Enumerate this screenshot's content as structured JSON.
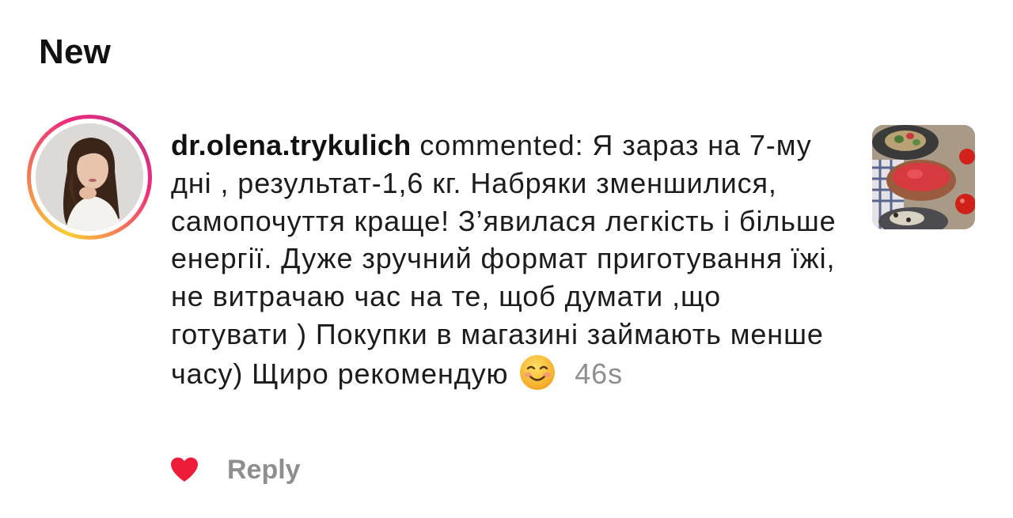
{
  "section": {
    "title": "New"
  },
  "comment": {
    "username": "dr.olena.trykulich",
    "action": "commented:",
    "text": "Я зараз на 7-му дні , результат-1,6 кг. Набряки зменшилися, самопочуття краще! З’явилася легкість і більше енергії. Дуже зручний формат приготування їжі, не витрачаю час на те, щоб думати ,що готувати ) Покупки в магазині займають менше часу) Щиро рекомендую",
    "emoji": "smiling-face-icon",
    "time": "46s"
  },
  "actions": {
    "like_icon": "heart-icon",
    "like_color": "#ed1c3a",
    "reply_label": "Reply"
  },
  "colors": {
    "story_ring_start": "#f9ce34",
    "story_ring_end": "#ee2a7b",
    "muted_text": "#8e8e8e"
  }
}
